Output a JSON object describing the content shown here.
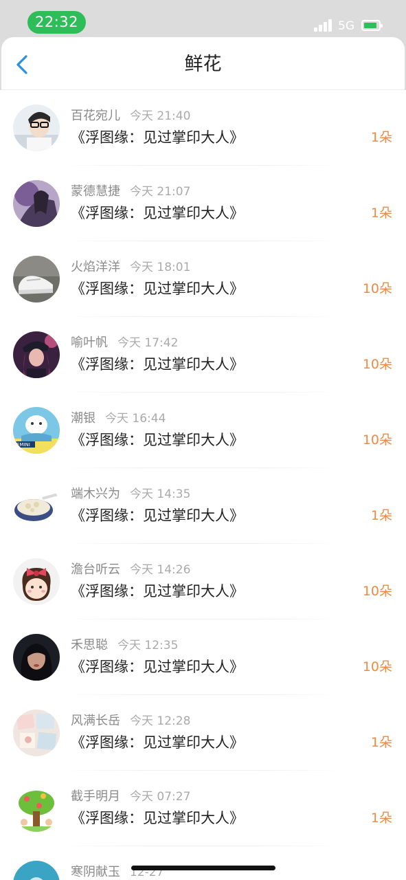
{
  "status_bar": {
    "time": "22:32",
    "network": "5G"
  },
  "header": {
    "title": "鲜花"
  },
  "records": [
    {
      "user": "百花宛儿",
      "time": "今天 21:40",
      "book": "《浮图缘：见过掌印大人》",
      "amount": "1朵"
    },
    {
      "user": "蒙德慧捷",
      "time": "今天 21:07",
      "book": "《浮图缘：见过掌印大人》",
      "amount": "1朵"
    },
    {
      "user": "火焰洋洋",
      "time": "今天 18:01",
      "book": "《浮图缘：见过掌印大人》",
      "amount": "10朵"
    },
    {
      "user": "喻叶帆",
      "time": "今天 17:42",
      "book": "《浮图缘：见过掌印大人》",
      "amount": "10朵"
    },
    {
      "user": "潮银",
      "time": "今天 16:44",
      "book": "《浮图缘：见过掌印大人》",
      "amount": "10朵"
    },
    {
      "user": "端木兴为",
      "time": "今天 14:35",
      "book": "《浮图缘：见过掌印大人》",
      "amount": "1朵"
    },
    {
      "user": "澹台听云",
      "time": "今天 14:26",
      "book": "《浮图缘：见过掌印大人》",
      "amount": "10朵"
    },
    {
      "user": "禾思聪",
      "time": "今天 12:35",
      "book": "《浮图缘：见过掌印大人》",
      "amount": "10朵"
    },
    {
      "user": "风满长岳",
      "time": "今天 12:28",
      "book": "《浮图缘：见过掌印大人》",
      "amount": "1朵"
    },
    {
      "user": "截手明月",
      "time": "今天 07:27",
      "book": "《浮图缘：见过掌印大人》",
      "amount": "1朵"
    },
    {
      "user": "寒阴献玉",
      "time": "12-27",
      "book": "",
      "amount": ""
    }
  ],
  "avatar_icons": [
    "man-glasses-avatar-icon",
    "ink-art-avatar-icon",
    "sneakers-avatar-icon",
    "girl-cap-avatar-icon",
    "gemini-cartoon-avatar-icon",
    "food-bowl-avatar-icon",
    "bow-girl-cartoon-avatar-icon",
    "girl-portrait-avatar-icon",
    "photos-collage-avatar-icon",
    "tree-cartoon-avatar-icon",
    "teal-avatar-icon"
  ],
  "colors": {
    "accent": "#2b8fe5",
    "amount": "#ee8a43",
    "time_pill": "#2ebd59"
  }
}
